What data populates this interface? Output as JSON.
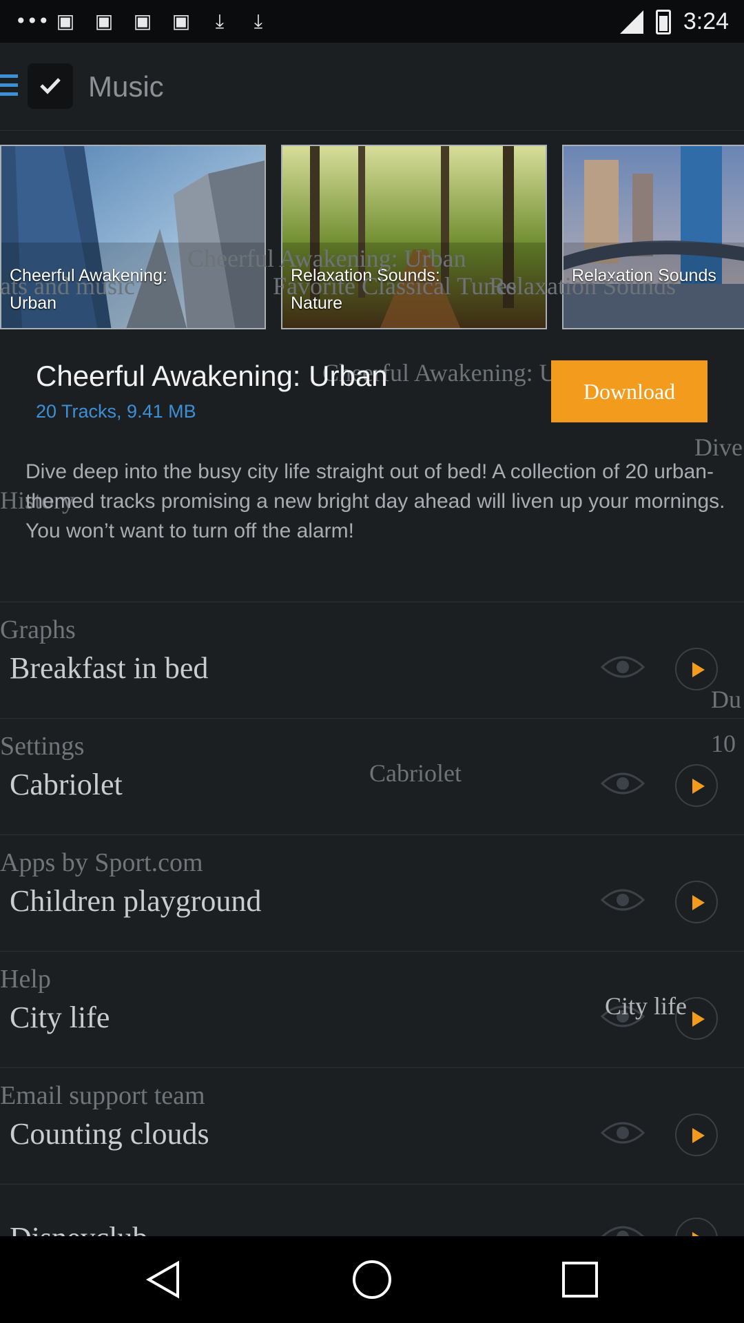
{
  "status_bar": {
    "time": "3:24"
  },
  "app_bar": {
    "title": "Music"
  },
  "carousel": [
    {
      "label_line1": "Cheerful Awakening:",
      "label_line2": "Urban"
    },
    {
      "label_line1": "Relaxation Sounds:",
      "label_line2": "Nature"
    },
    {
      "label_line1": "",
      "label_line2": "Relaxation Sounds"
    }
  ],
  "ghost_text": {
    "g1": "Cheerful Awakening: Urban",
    "g2": "ats and music",
    "g3": "Favorite Classical Tunes",
    "g4": "Relaxation Sounds",
    "g5": "Cheerful Awakening: Urban",
    "g6": "Dive",
    "g7": "History",
    "g8": "Du",
    "g9": "10",
    "g10": "Cabriolet",
    "g11": "City life"
  },
  "album": {
    "title": "Cheerful Awakening: Urban",
    "meta": "20 Tracks, 9.41 MB",
    "download_label": "Download",
    "description": "Dive deep into the busy city life straight out of bed! A collection of 20 urban-themed tracks promising a new bright day ahead will liven up your mornings.  You won’t want to turn off the alarm!"
  },
  "sections": [
    {
      "label": "Graphs",
      "track": "Breakfast in bed"
    },
    {
      "label": "Settings",
      "track": "Cabriolet"
    },
    {
      "label": "Apps by Sport.com",
      "track": "Children playground"
    },
    {
      "label": "Help",
      "track": "City life"
    },
    {
      "label": "Email support team",
      "track": "Counting clouds"
    },
    {
      "label": "",
      "track": "Disneyclub"
    }
  ],
  "colors": {
    "accent": "#3d8fd6",
    "download": "#f29b1c",
    "play": "#f29b1c",
    "background": "#1b1f22"
  }
}
